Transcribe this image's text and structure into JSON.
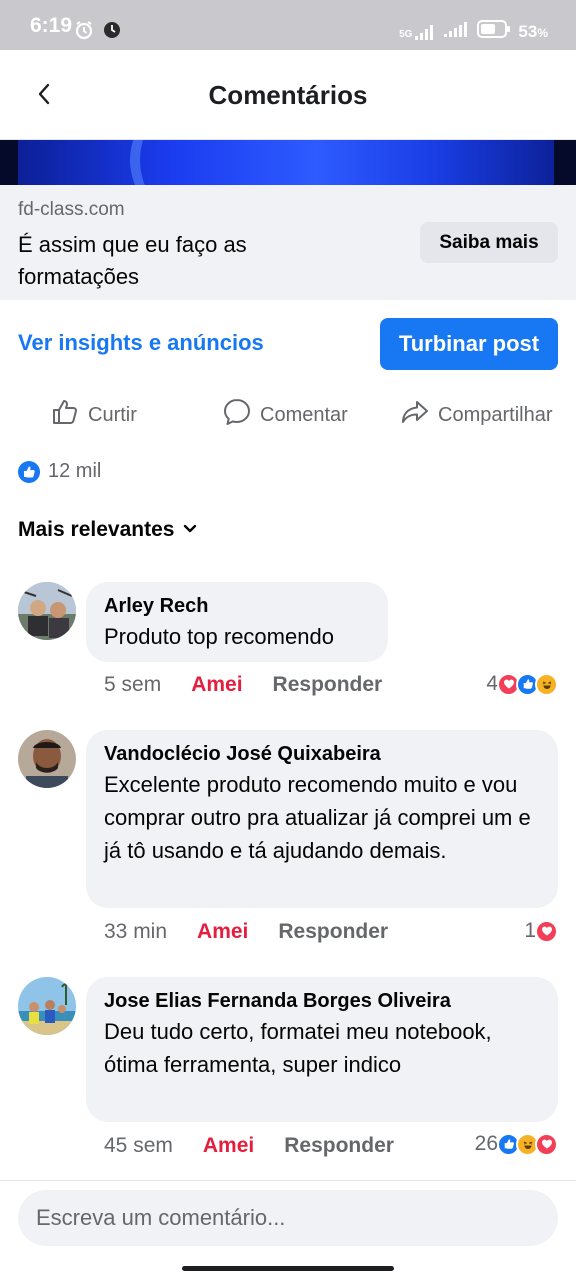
{
  "status_bar": {
    "time": "6:19",
    "battery": "53",
    "battery_unit": "%",
    "network": "5G",
    "icons": [
      "alarm-icon",
      "record-icon",
      "signal-icon",
      "signal-icon",
      "battery-icon"
    ]
  },
  "header": {
    "title": "Comentários",
    "back_icon": "chevron-left-icon"
  },
  "link_card": {
    "domain": "fd-class.com",
    "title": "É assim que eu faço as formatações",
    "cta": "Saiba mais"
  },
  "promo": {
    "insights": "Ver insights e anúncios",
    "boost": "Turbinar post"
  },
  "actions": {
    "like": "Curtir",
    "comment": "Comentar",
    "share": "Compartilhar"
  },
  "reactions_summary": {
    "count": "12 mil"
  },
  "sort": {
    "label": "Mais relevantes"
  },
  "comments": [
    {
      "author": "Arley Rech",
      "text": "Produto top recomendo",
      "time": "5 sem",
      "love_label": "Amei",
      "reply_label": "Responder",
      "reaction_count": "4",
      "reactions": [
        "love",
        "like",
        "haha"
      ]
    },
    {
      "author": "Vandoclécio José Quixabeira",
      "text": "Excelente produto recomendo muito e vou comprar outro pra atualizar já comprei um e já tô usando e tá ajudando demais.",
      "time": "33 min",
      "love_label": "Amei",
      "reply_label": "Responder",
      "reaction_count": "1",
      "reactions": [
        "love"
      ]
    },
    {
      "author": "Jose Elias Fernanda Borges Oliveira",
      "text": "Deu tudo certo, formatei meu notebook, ótima ferramenta, super indico",
      "time": "45 sem",
      "love_label": "Amei",
      "reply_label": "Responder",
      "reaction_count": "26",
      "reactions": [
        "like",
        "haha",
        "love"
      ]
    }
  ],
  "composer": {
    "placeholder": "Escreva um comentário..."
  },
  "colors": {
    "accent": "#1877f2",
    "love": "#e41e3f",
    "bubble": "#f0f2f5",
    "secondary_text": "#65676b"
  }
}
